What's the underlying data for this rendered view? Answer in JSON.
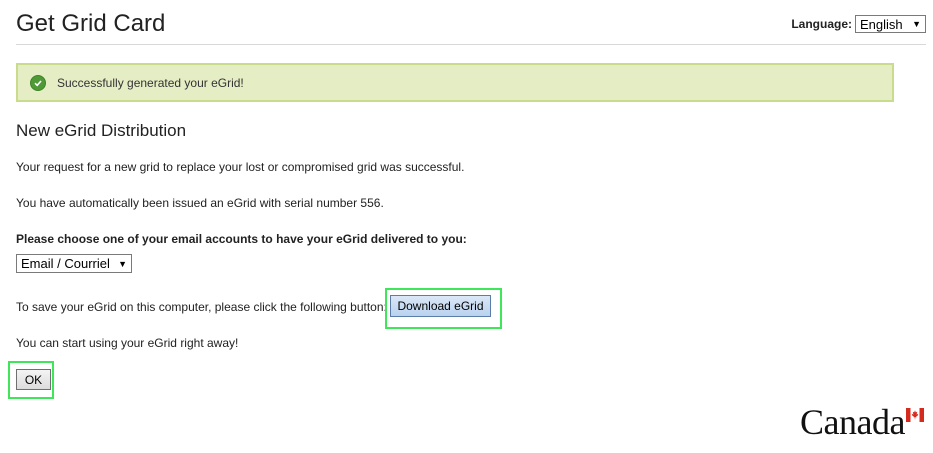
{
  "header": {
    "title": "Get Grid Card",
    "language_label": "Language:",
    "language_value": "English"
  },
  "alert": {
    "message": "Successfully generated your eGrid!",
    "icon": "check-circle-icon",
    "colors": {
      "background": "#e5edc5",
      "border": "#c9dc8c",
      "icon": "#4f9a37"
    }
  },
  "main": {
    "section_title": "New eGrid Distribution",
    "request_text": "Your request for a new grid to replace your lost or compromised grid was successful.",
    "serial_text": "You have automatically been issued an eGrid with serial number 556.",
    "email_prompt": "Please choose one of your email accounts to have your eGrid delivered to you:",
    "email_select_value": "Email / Courriel",
    "save_text": "To save your eGrid on this computer, please click the following button:",
    "download_button": "Download eGrid",
    "start_text": "You can start using your eGrid right away!",
    "ok_button": "OK"
  },
  "footer": {
    "wordmark": "Canada",
    "flag_icon": "canada-flag-icon"
  },
  "accent_colors": {
    "highlight_box": "#3fe65a",
    "flag_red": "#d52b1e"
  }
}
